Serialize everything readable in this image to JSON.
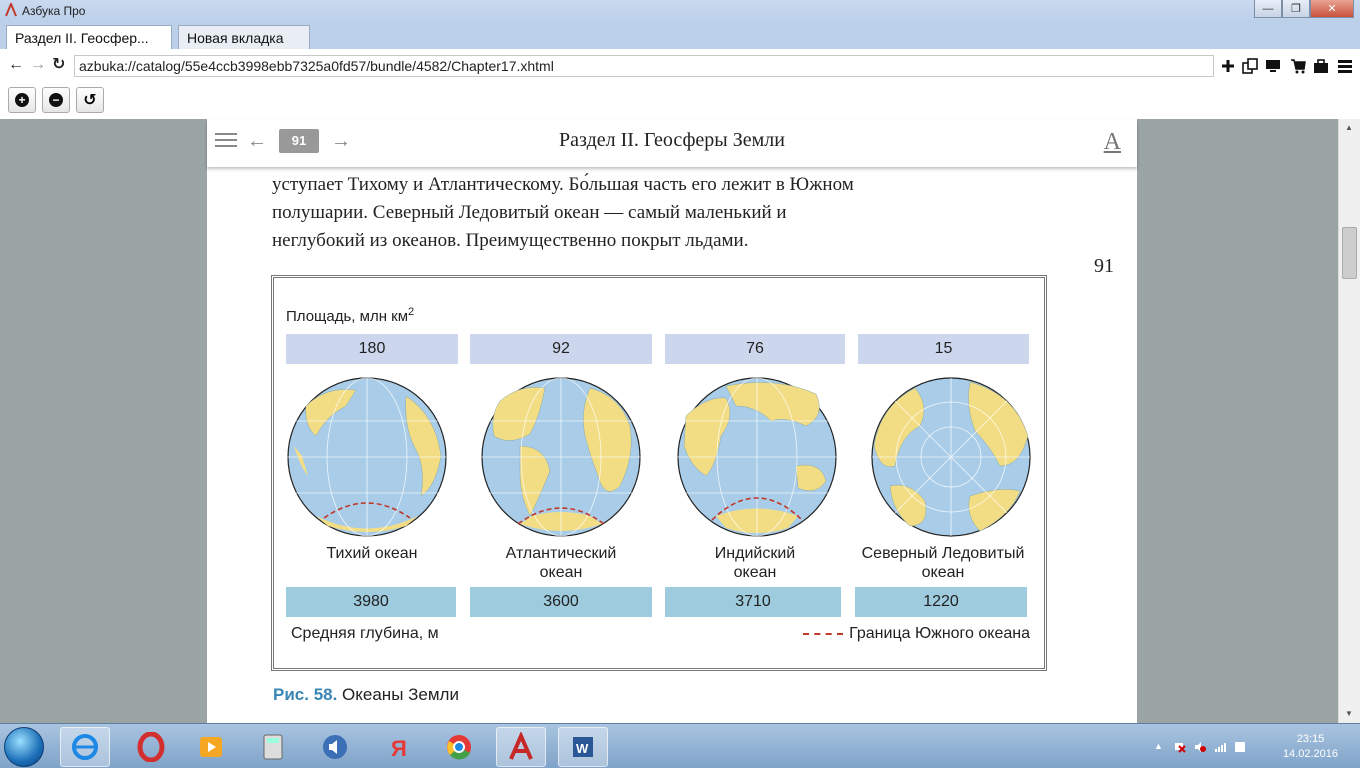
{
  "window": {
    "app_title": "Азбука Про",
    "min_icon": "minimize-icon",
    "max_icon": "restore-icon",
    "close_icon": "close-icon"
  },
  "tabs": [
    {
      "label": "Раздел II. Геосфер..."
    },
    {
      "label": "Новая вкладка"
    }
  ],
  "nav": {
    "address": "azbuka://catalog/55e4ccb3998ebb7325a0fd57/bundle/4582/Chapter17.xhtml"
  },
  "zoom": {
    "zoom_in_icon": "plus-icon",
    "zoom_out_icon": "minus-icon",
    "reset_icon": "reset-icon"
  },
  "reader": {
    "page_badge": "91",
    "title": "Раздел II. Геосферы Земли",
    "font_icon": "A"
  },
  "content": {
    "lines": [
      "уступает Тихому и Атлантическому. Бо́льшая часть его лежит в Южном",
      "полушарии. Северный Ледовитый океан — самый маленький и",
      "неглубокий из океанов. Преимущественно покрыт льдами."
    ],
    "page_number": "91"
  },
  "figure": {
    "area_label": "Площадь, млн км",
    "area_sup": "2",
    "oceans": [
      {
        "name_l1": "Тихий океан",
        "name_l2": "",
        "area": "180",
        "depth": "3980"
      },
      {
        "name_l1": "Атлантический",
        "name_l2": "океан",
        "area": "92",
        "depth": "3600"
      },
      {
        "name_l1": "Индийский",
        "name_l2": "океан",
        "area": "76",
        "depth": "3710"
      },
      {
        "name_l1": "Северный Ледовитый",
        "name_l2": "океан",
        "area": "15",
        "depth": "1220"
      }
    ],
    "depth_label": "Средняя глубина, м",
    "legend_label": "Граница Южного океана",
    "colors": {
      "ocean": "#a9cde8",
      "land": "#f3dd84",
      "border": "#c0392b",
      "area_fill": "#ccd7ee",
      "depth_fill": "#9ecbde"
    }
  },
  "caption": {
    "number": "Рис. 58.",
    "text": " Океаны Земли"
  },
  "taskbar": {
    "time": "23:15",
    "date": "14.02.2016"
  }
}
